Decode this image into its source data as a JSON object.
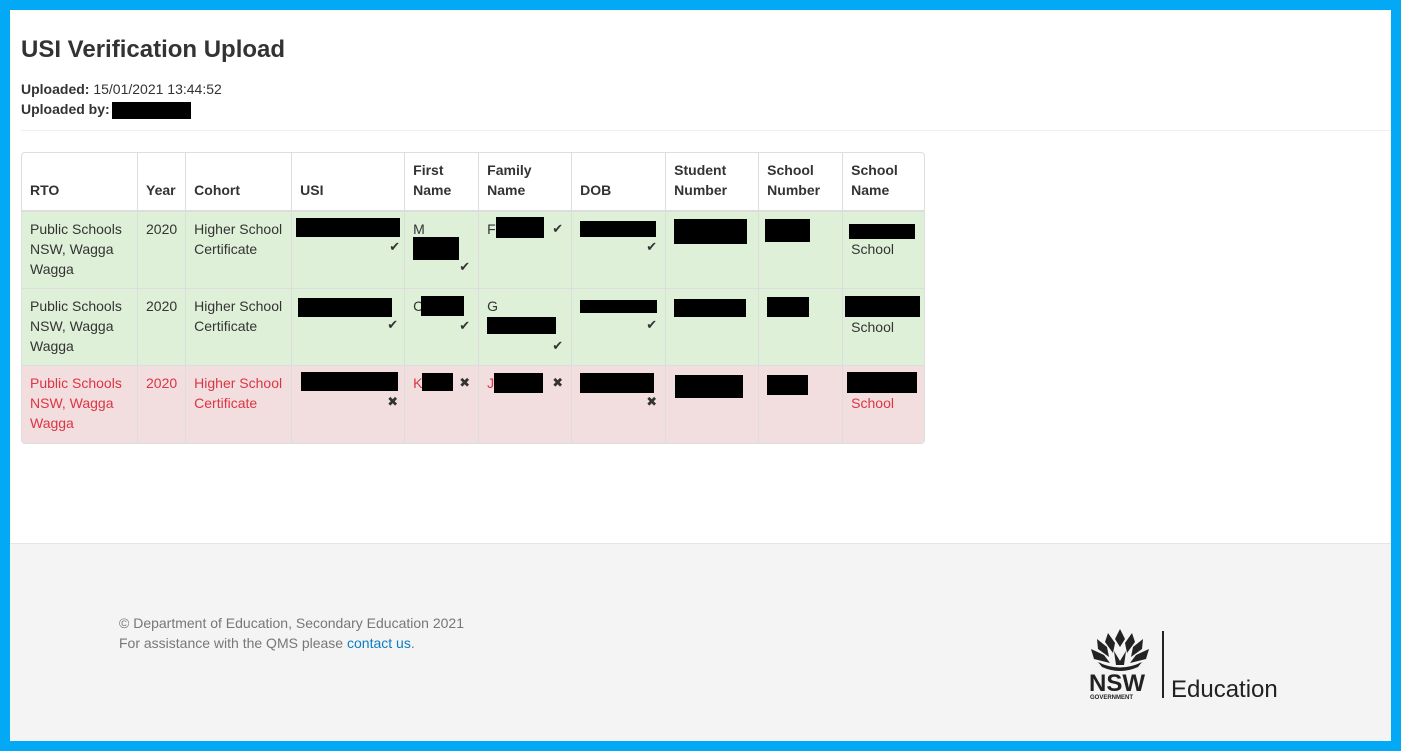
{
  "page": {
    "title": "USI Verification Upload",
    "uploaded_label": "Uploaded:",
    "uploaded_value": "15/01/2021 13:44:52",
    "uploaded_by_label": "Uploaded by:",
    "uploaded_by_value": "[redacted]"
  },
  "table": {
    "columns": [
      "RTO",
      "Year",
      "Cohort",
      "USI",
      "First Name",
      "Family Name",
      "DOB",
      "Student Number",
      "School Number",
      "School Name"
    ],
    "rows": [
      {
        "status": "verified",
        "rto": "Public Schools NSW, Wagga Wagga",
        "year": "2020",
        "cohort": "Higher School Certificate",
        "usi": "[redacted]",
        "usi_status": "check-icon",
        "first_name_initial": "M",
        "first_name_status": "check-icon",
        "family_name_initial": "F",
        "family_name_status": "check-icon",
        "dob": "[redacted]",
        "dob_status": "check-icon",
        "student_number": "[redacted]",
        "school_number": "[redacted]",
        "school_name_suffix": "School"
      },
      {
        "status": "verified",
        "rto": "Public Schools NSW, Wagga Wagga",
        "year": "2020",
        "cohort": "Higher School Certificate",
        "usi": "[redacted]",
        "usi_status": "check-icon",
        "first_name_initial": "C",
        "first_name_status": "check-icon",
        "family_name_initial": "G",
        "family_name_status": "check-icon",
        "dob": "[redacted]",
        "dob_status": "check-icon",
        "student_number": "[redacted]",
        "school_number": "[redacted]",
        "school_name_suffix": "School"
      },
      {
        "status": "failed",
        "rto": "Public Schools NSW, Wagga Wagga",
        "year": "2020",
        "cohort": "Higher School Certificate",
        "usi": "[redacted]",
        "usi_status": "cross-icon",
        "first_name_initial": "K",
        "first_name_status": "cross-icon",
        "family_name_initial": "J",
        "family_name_status": "cross-icon",
        "dob": "[redacted]",
        "dob_status": "cross-icon",
        "student_number": "[redacted]",
        "school_number": "[redacted]",
        "school_name_suffix": "School"
      }
    ]
  },
  "icons": {
    "check": "✔",
    "cross": "✖"
  },
  "footer": {
    "copyright": "© Department of Education, Secondary Education 2021",
    "assist_text": "For assistance with the QMS please ",
    "contact_link": "contact us",
    "assist_end": ".",
    "logo_nsw": "NSW",
    "logo_gov": "GOVERNMENT",
    "logo_edu": "Education"
  },
  "colors": {
    "frame": "#03a9f4",
    "success_bg": "#dff0d8",
    "danger_bg": "#f2dede",
    "danger_text": "#dc3545",
    "link": "#0a7ec2"
  }
}
